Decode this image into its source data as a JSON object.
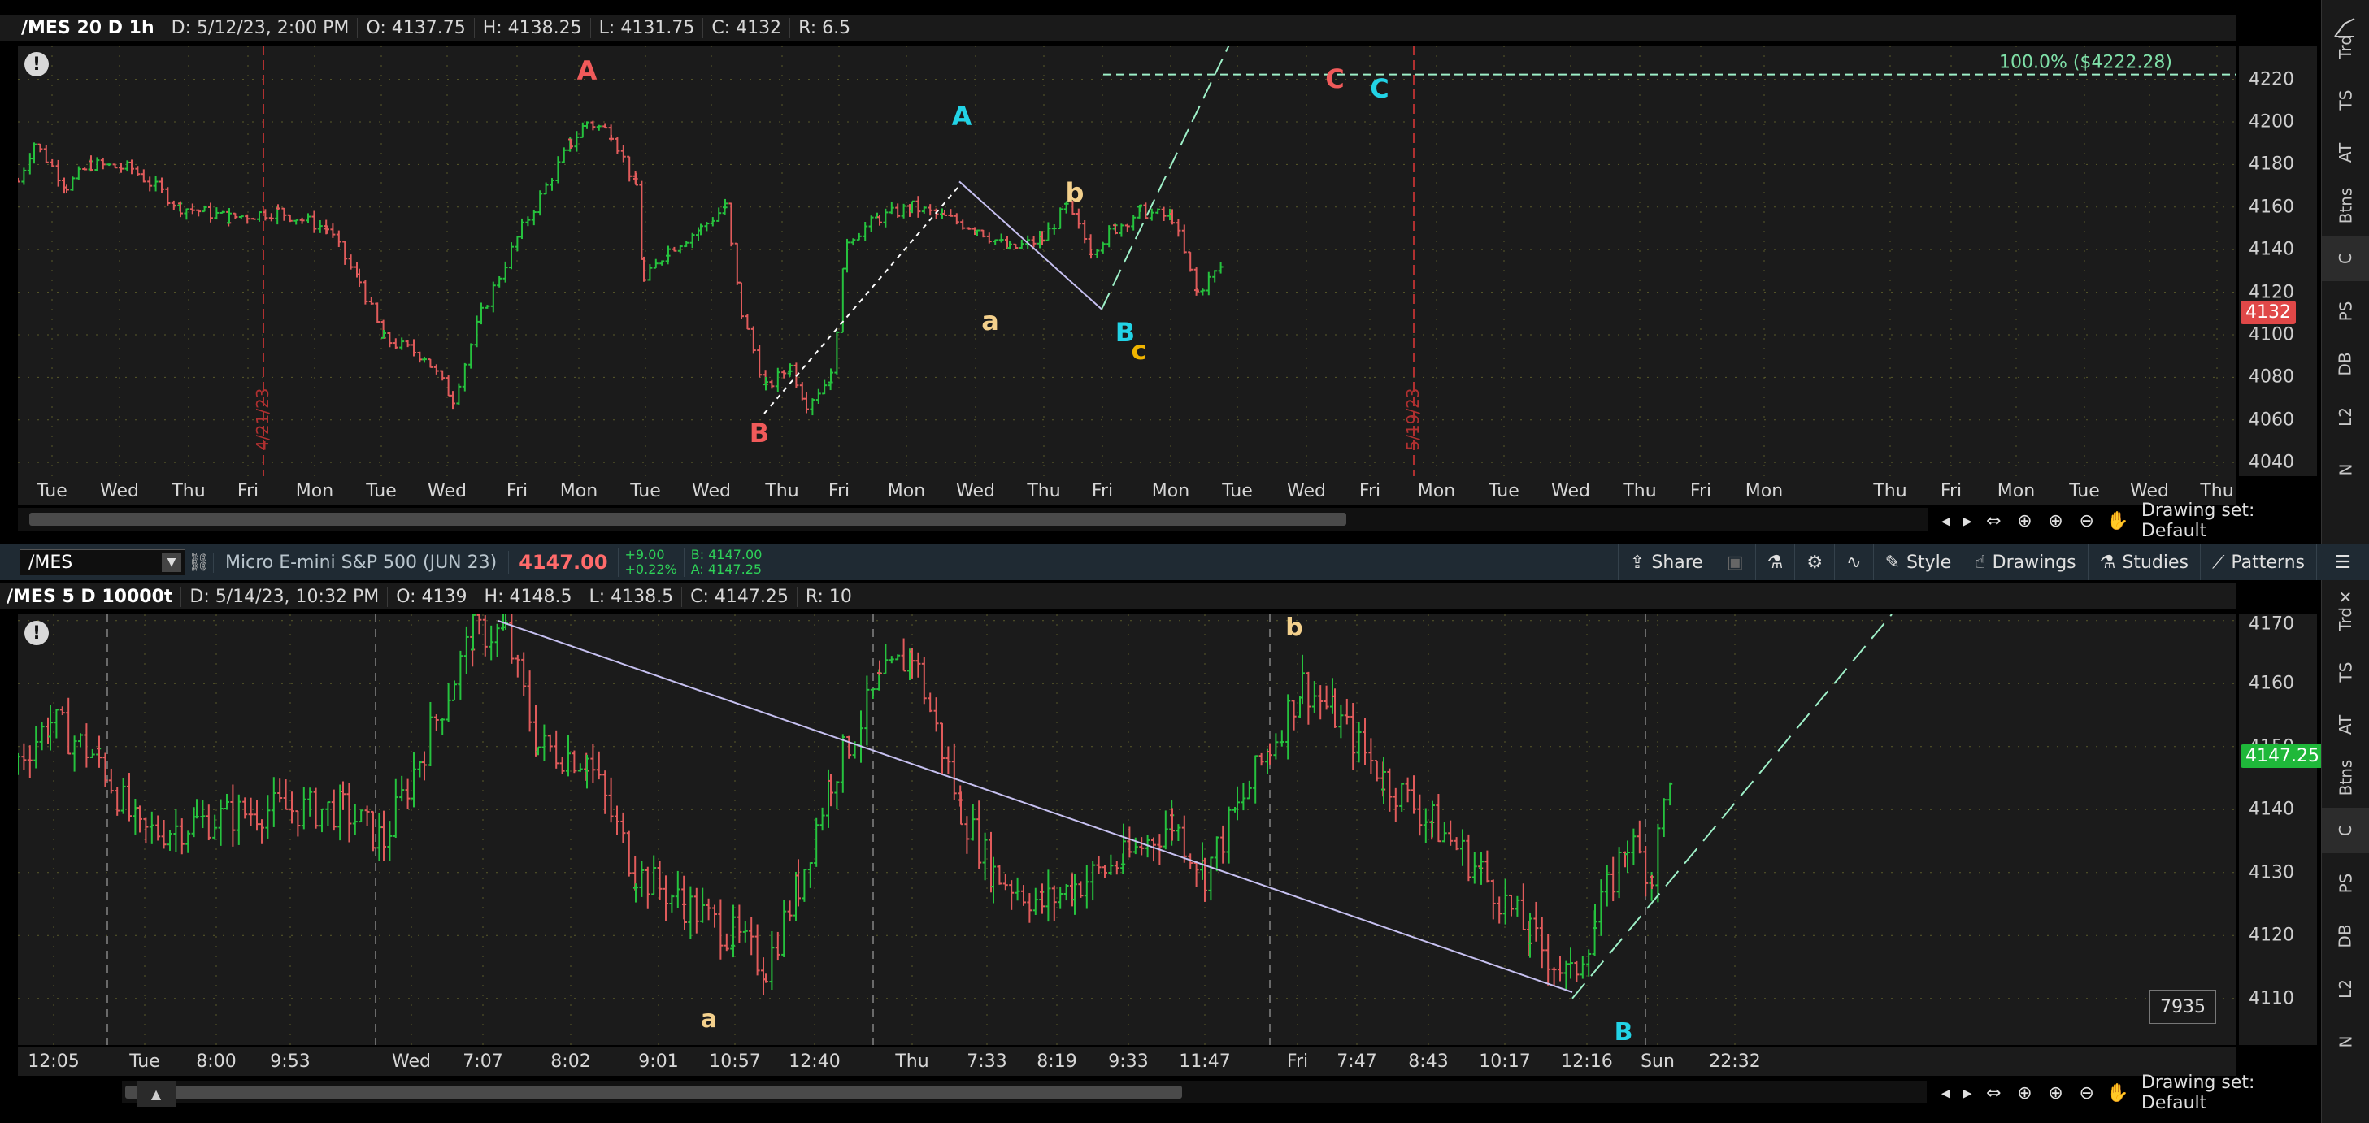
{
  "top_chart": {
    "info": {
      "symbol": "/MES 20 D 1h",
      "date": "D: 5/12/23, 2:00 PM",
      "open": "O: 4137.75",
      "high": "H: 4138.25",
      "low": "L: 4131.75",
      "close": "C: 4132",
      "range": "R: 6.5"
    },
    "price_axis": [
      "4220",
      "4200",
      "4180",
      "4160",
      "4140",
      "4120",
      "4100",
      "4080",
      "4060",
      "4040"
    ],
    "last_price": "4132",
    "fib_label": "100.0%  ($4222.28)",
    "date_markers": [
      "4/21/23",
      "5/19/23"
    ],
    "time_axis": [
      "Tue",
      "Wed",
      "Thu",
      "Fri",
      "Mon",
      "Tue",
      "Wed",
      "Fri",
      "Mon",
      "Tue",
      "Wed",
      "Thu",
      "Fri",
      "Mon",
      "Wed",
      "Thu",
      "Fri",
      "Mon",
      "Tue",
      "Wed",
      "Fri",
      "Mon",
      "Tue",
      "Wed",
      "Thu",
      "Fri",
      "Mon",
      "Thu",
      "Fri",
      "Mon",
      "Tue",
      "Wed",
      "Thu"
    ],
    "wave_labels": [
      "A",
      "B",
      "A",
      "a",
      "b",
      "B",
      "c",
      "C",
      "C"
    ],
    "drawing_set": "Drawing set: Default"
  },
  "toolbar": {
    "symbol": "/MES",
    "description": "Micro E-mini S&P 500 (JUN 23)",
    "last": "4147.00",
    "change": "+9.00",
    "change_pct": "+0.22%",
    "bid": "B: 4147.00",
    "ask": "A: 4147.25",
    "share": "Share",
    "style": "Style",
    "drawings": "Drawings",
    "studies": "Studies",
    "patterns": "Patterns"
  },
  "bottom_chart": {
    "info": {
      "symbol": "/MES 5 D 10000t",
      "date": "D: 5/14/23, 10:32 PM",
      "open": "O: 4139",
      "high": "H: 4148.5",
      "low": "L: 4138.5",
      "close": "C: 4147.25",
      "range": "R: 10"
    },
    "price_axis": [
      "4170",
      "4160",
      "4150",
      "4140",
      "4130",
      "4120",
      "4110"
    ],
    "last_price": "4147.25",
    "volume_box": "7935",
    "time_axis": [
      "12:05",
      "Tue",
      "8:00",
      "9:53",
      "Wed",
      "7:07",
      "8:02",
      "9:01",
      "10:57",
      "12:40",
      "Thu",
      "7:33",
      "8:19",
      "9:33",
      "11:47",
      "Fri",
      "7:47",
      "8:43",
      "10:17",
      "12:16",
      "Sun",
      "22:32"
    ],
    "wave_labels": [
      "b",
      "a",
      "B"
    ],
    "drawing_set": "Drawing set: Default"
  },
  "side_tabs": {
    "top": [
      "Trd",
      "TS",
      "AT",
      "Btns",
      "C",
      "PS",
      "DB",
      "L2",
      "N"
    ],
    "bottom": [
      "Trd",
      "TS",
      "AT",
      "Btns",
      "C",
      "PS",
      "DB",
      "L2",
      "N"
    ]
  },
  "colors": {
    "up": "#26c23e",
    "down": "#e05b5b",
    "wave_red": "#f05a5a",
    "wave_cyan": "#22d3e6",
    "wave_yellow": "#f3d08c",
    "wave_orange": "#f0b400",
    "trendline": "#c6c0f0",
    "dashed": "#9ef0c8"
  }
}
